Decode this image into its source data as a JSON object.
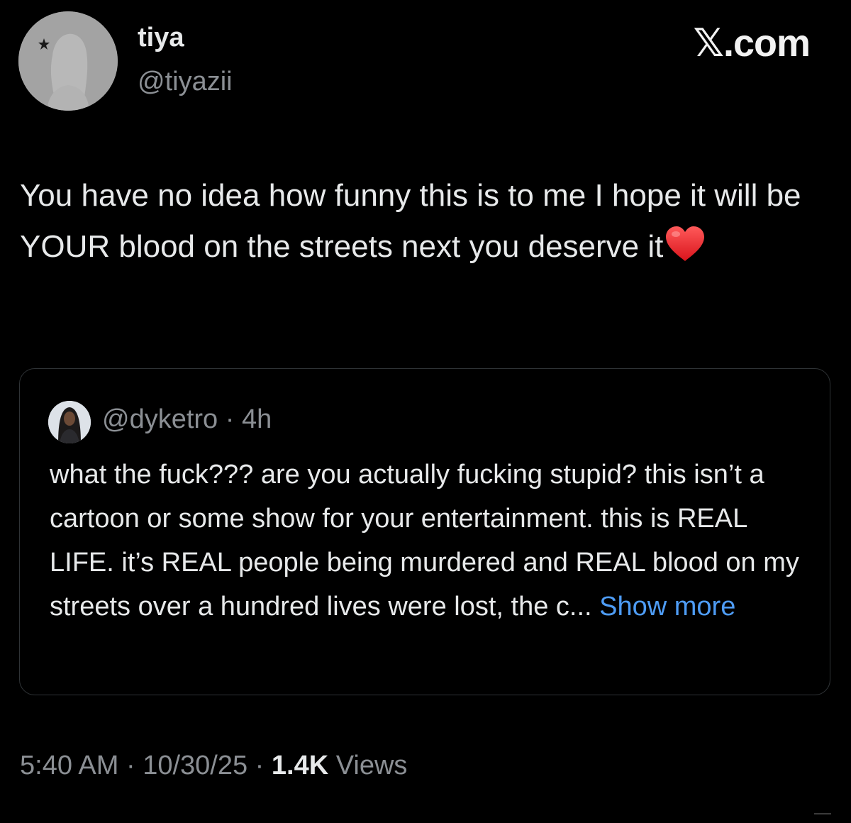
{
  "author": {
    "display_name": "tiya",
    "handle": "@tiyazii",
    "avatar_icon": "default-profile-silhouette-icon"
  },
  "brand": {
    "x_glyph": "𝕏",
    "suffix": ".com"
  },
  "tweet": {
    "text": "You have no idea how funny this is to me I hope it will be YOUR blood on the streets next you deserve it",
    "emoji": "heart-icon"
  },
  "quote": {
    "handle": "@dyketro",
    "separator": " · ",
    "time": "4h",
    "text": "what the fuck??? are you actually fucking stupid? this isn’t a cartoon or some show for your entertainment. this is REAL LIFE. it’s REAL people being murdered and REAL blood on my streets over a hundred lives were lost, the c... ",
    "show_more": "Show more"
  },
  "footer": {
    "time": "5:40 AM",
    "sep1": " · ",
    "date": "10/30/25",
    "sep2": " · ",
    "views_count": "1.4K",
    "views_label": " Views"
  },
  "colors": {
    "background": "#000000",
    "primary_text": "#e7e9ea",
    "secondary_text": "#8b8f94",
    "link": "#4e9cf5",
    "border": "#2f3336"
  }
}
